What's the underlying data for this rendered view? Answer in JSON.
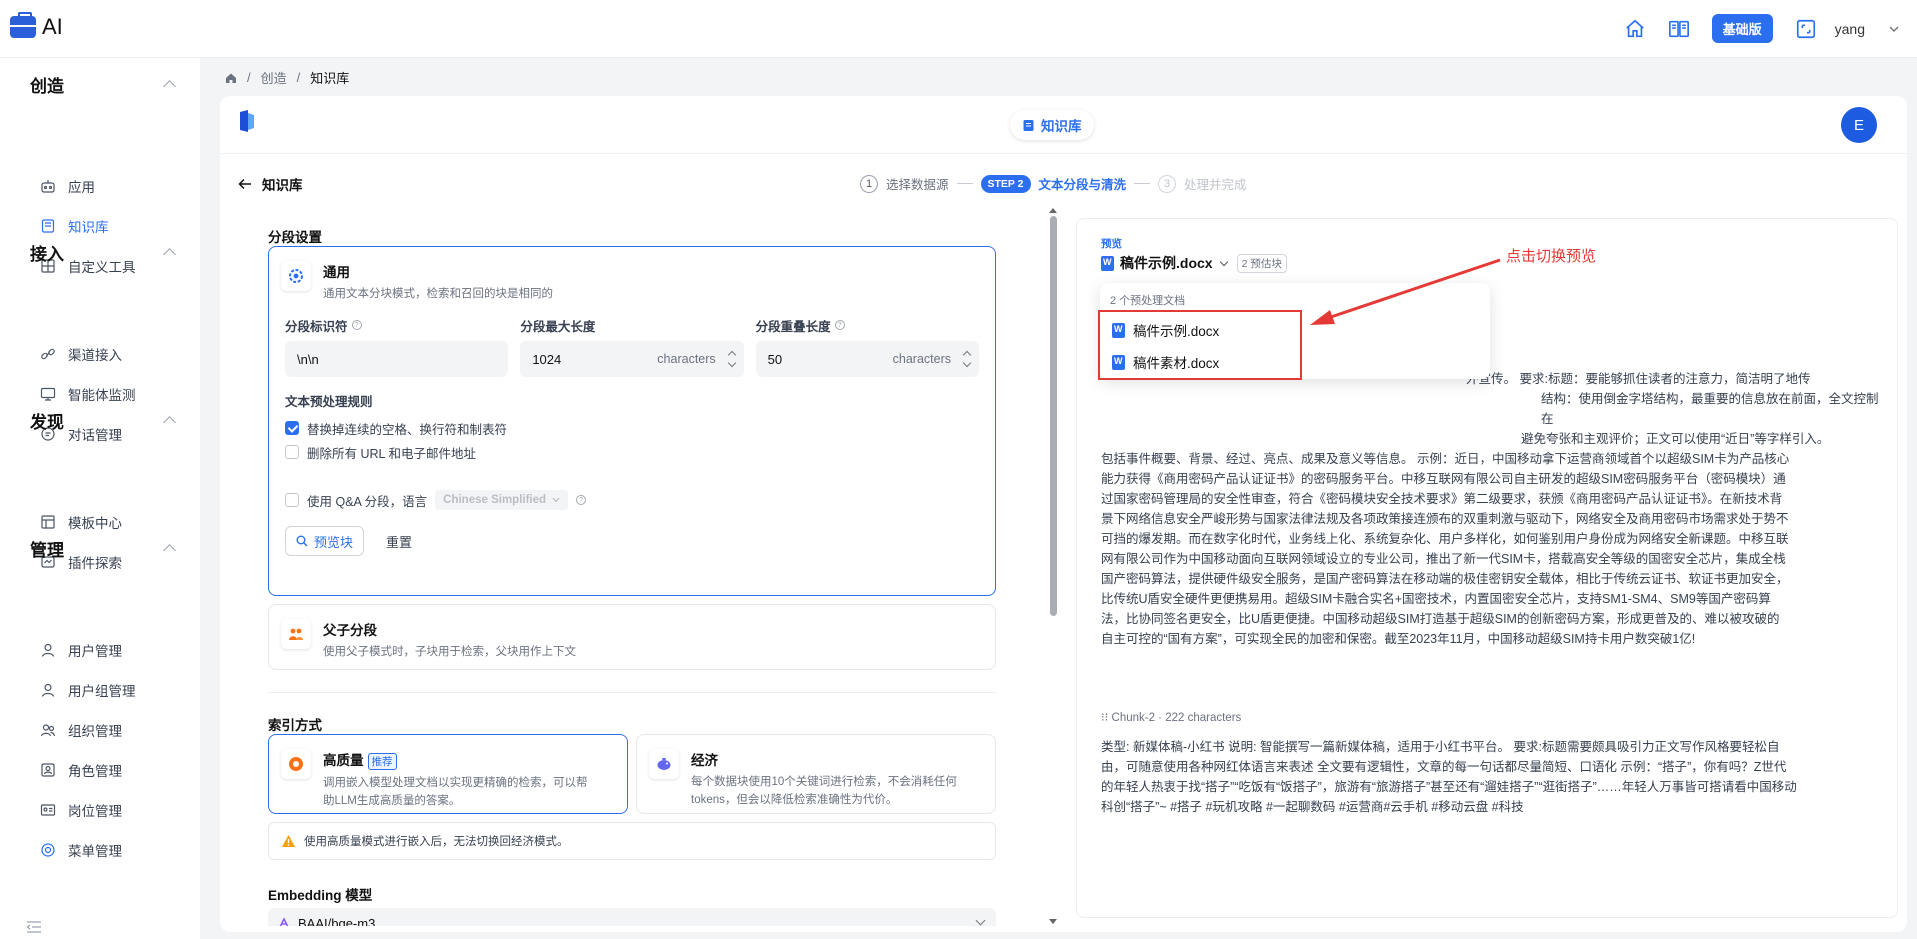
{
  "app": {
    "name": "AI",
    "plan": "基础版",
    "user": "yang"
  },
  "sidebar": {
    "sections": [
      {
        "title": "创造",
        "items": [
          {
            "label": "应用",
            "icon": "robot-icon"
          },
          {
            "label": "知识库",
            "icon": "book-icon",
            "active": true
          },
          {
            "label": "自定义工具",
            "icon": "tools-icon"
          }
        ]
      },
      {
        "title": "接入",
        "items": [
          {
            "label": "渠道接入",
            "icon": "link-icon"
          },
          {
            "label": "智能体监测",
            "icon": "monitor-icon"
          },
          {
            "label": "对话管理",
            "icon": "chat-icon"
          }
        ]
      },
      {
        "title": "发现",
        "items": [
          {
            "label": "模板中心",
            "icon": "template-icon"
          },
          {
            "label": "插件探索",
            "icon": "plugin-icon"
          }
        ]
      },
      {
        "title": "管理",
        "items": [
          {
            "label": "用户管理",
            "icon": "user-icon"
          },
          {
            "label": "用户组管理",
            "icon": "user-group-icon"
          },
          {
            "label": "组织管理",
            "icon": "org-icon"
          },
          {
            "label": "角色管理",
            "icon": "role-icon"
          },
          {
            "label": "岗位管理",
            "icon": "post-icon"
          },
          {
            "label": "菜单管理",
            "icon": "menu-gear-icon"
          }
        ]
      }
    ]
  },
  "breadcrumb": {
    "items": [
      "创造",
      "知识库"
    ]
  },
  "header": {
    "pill": "知识库",
    "avatar": "E"
  },
  "subheader": {
    "back_label": "知识库",
    "steps": [
      {
        "num": "1",
        "label": "选择数据源"
      },
      {
        "badge": "STEP 2",
        "label": "文本分段与清洗"
      },
      {
        "num": "3",
        "label": "处理并完成"
      }
    ]
  },
  "segment": {
    "section_label": "分段设置",
    "general": {
      "title": "通用",
      "desc": "通用文本分块模式，检索和召回的块是相同的"
    },
    "fields": [
      {
        "label": "分段标识符",
        "value": "\\n\\n",
        "unit": ""
      },
      {
        "label": "分段最大长度",
        "value": "1024",
        "unit": "characters"
      },
      {
        "label": "分段重叠长度",
        "value": "50",
        "unit": "characters"
      }
    ],
    "rules_label": "文本预处理规则",
    "rules": [
      {
        "label": "替换掉连续的空格、换行符和制表符",
        "checked": true
      },
      {
        "label": "删除所有 URL 和电子邮件地址",
        "checked": false
      }
    ],
    "qa": {
      "label": "使用 Q&A 分段，语言",
      "language": "Chinese Simplified",
      "checked": false
    },
    "preview_btn": "预览块",
    "reset_btn": "重置",
    "parent_child": {
      "title": "父子分段",
      "desc": "使用父子模式时，子块用于检索，父块用作上下文"
    }
  },
  "index": {
    "label": "索引方式",
    "high": {
      "title": "高质量",
      "tag": "推荐",
      "desc_1": "调用嵌入模型处理文档以实现更精确的检索，可以帮",
      "desc_2": "助LLM生成高质量的答案。"
    },
    "eco": {
      "title": "经济",
      "desc_1": "每个数据块使用10个关键词进行检索，不会消耗任何",
      "desc_2": "tokens，但会以降低检索准确性为代价。"
    },
    "warning": "使用高质量模式进行嵌入后，无法切换回经济模式。"
  },
  "embedding": {
    "label": "Embedding 模型",
    "value": "BAAI/bge-m3"
  },
  "preview": {
    "title": "预览",
    "doc": "稿件示例.docx",
    "chunk_count": "2 预估块",
    "dropdown_label": "2 个预处理文档",
    "docs": [
      "稿件示例.docx",
      "稿件素材.docx"
    ],
    "chunk1_lines": [
      "外宣传。 要求:标题：要能够抓住读者的注意力，简洁明了地传",
      "结构：使用倒金字塔结构，最重要的信息放在前面，全文控制在",
      "避免夸张和主观评价；正文可以使用“近日”等字样引入。",
      "包括事件概要、背景、经过、亮点、成果及意义等信息。 示例：近日，中国移动拿下运营商领域首个以超级SIM卡为产品核心",
      "能力获得《商用密码产品认证证书》的密码服务平台。中移互联网有限公司自主研发的超级SIM密码服务平台（密码模块）通",
      "过国家密码管理局的安全性审查，符合《密码模块安全技术要求》第二级要求，获颁《商用密码产品认证证书》。在新技术背",
      "景下网络信息安全严峻形势与国家法律法规及各项政策接连颁布的双重刺激与驱动下，网络安全及商用密码市场需求处于势不",
      "可挡的爆发期。而在数字化时代，业务线上化、系统复杂化、用户多样化，如何鉴别用户身份成为网络安全新课题。中移互联",
      "网有限公司作为中国移动面向互联网领域设立的专业公司，推出了新一代SIM卡，搭载高安全等级的国密安全芯片，集成全栈",
      "国产密码算法，提供硬件级安全服务，是国产密码算法在移动端的极佳密钥安全载体，相比于传统云证书、软证书更加安全，",
      "比传统U盾安全硬件更便携易用。超级SIM卡融合实名+国密技术，内置国密安全芯片，支持SM1-SM4、SM9等国产密码算",
      "法，比协同签名更安全，比U盾更便捷。中国移动超级SIM打造基于超级SIM的创新密码方案，形成更普及的、难以被攻破的",
      "自主可控的“国有方案”，可实现全民的加密和保密。截至2023年11月，中国移动超级SIM持卡用户数突破1亿!"
    ],
    "chunk2_meta": "Chunk-2 · 222 characters",
    "chunk2_lines": [
      "类型: 新媒体稿-小红书 说明: 智能撰写一篇新媒体稿，适用于小红书平台。 要求:标题需要颇具吸引力正文写作风格要轻松自",
      "由，可随意使用各种网红体语言来表述 全文要有逻辑性，文章的每一句话都尽量简短、口语化 示例：“搭子”，你有吗？Z世代",
      "的年轻人热衷于找“搭子”“吃饭有“饭搭子”，旅游有“旅游搭子”甚至还有“遛娃搭子”“逛街搭子”……年轻人万事皆可搭请看中国移动",
      "科创“搭子”~ #搭子 #玩机攻略 #一起聊数码 #运营商#云手机 #移动云盘 #科技"
    ]
  },
  "annotation": {
    "label": "点击切换预览",
    "color": "#e53935"
  },
  "colors": {
    "accent": "#2b6ff0"
  }
}
